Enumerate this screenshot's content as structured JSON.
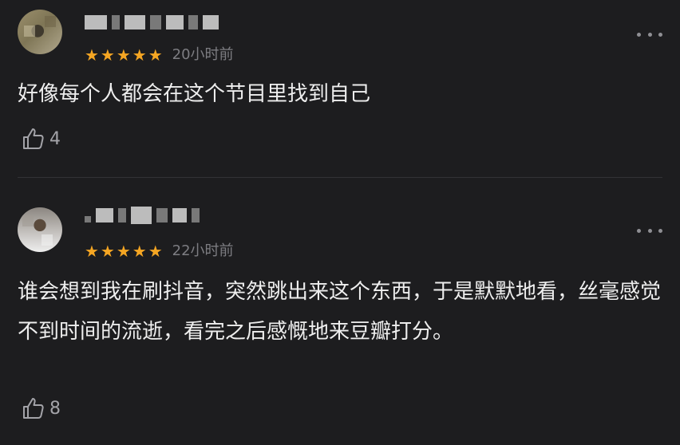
{
  "comments": [
    {
      "rating": "★★★★★",
      "time": "20小时前",
      "content": "好像每个人都会在这个节目里找到自己",
      "likes": "4"
    },
    {
      "rating": "★★★★★",
      "time": "22小时前",
      "content": "谁会想到我在刷抖音，突然跳出来这个东西，于是默默地看，丝毫感觉不到时间的流逝，看完之后感慨地来豆瓣打分。",
      "likes": "8"
    }
  ],
  "colors": {
    "background": "#1d1d1f",
    "star": "#f5a623",
    "text": "#eeeeee",
    "muted": "#7d7d82"
  }
}
